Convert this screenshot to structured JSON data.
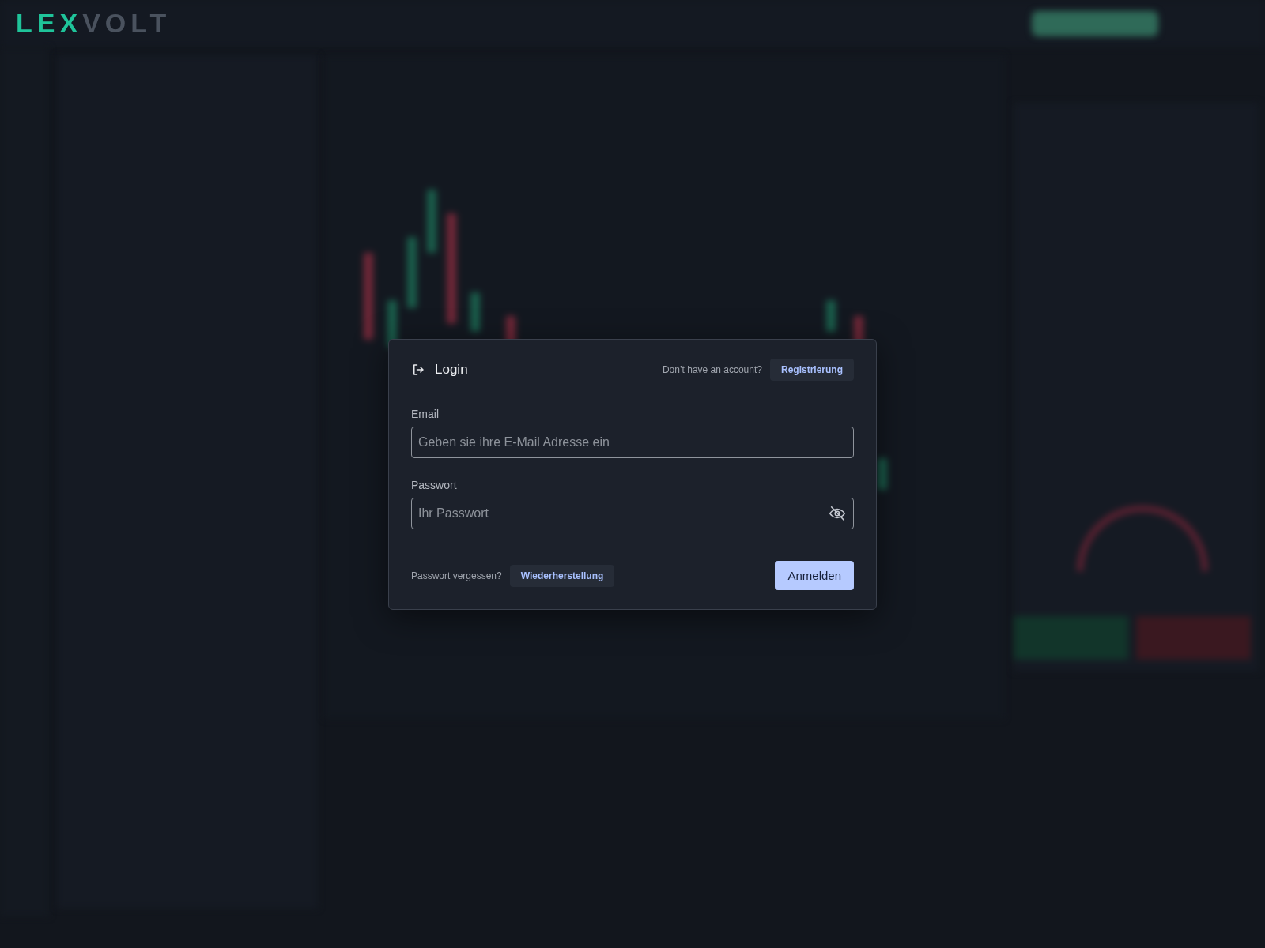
{
  "logo": {
    "accent": "LEX",
    "rest": "VOLT"
  },
  "dialog": {
    "title": "Login",
    "signup_prompt": "Don’t have an account?",
    "signup_button": "Registrierung",
    "fields": [
      {
        "label": "Email",
        "placeholder": "Geben sie ihre E-Mail Adresse ein",
        "kind": "email"
      },
      {
        "label": "Passwort",
        "placeholder": "Ihr Passwort",
        "kind": "password"
      }
    ],
    "forgot_prompt": "Passwort vergessen?",
    "recover_button": "Wiederherstellung",
    "submit_button": "Anmelden"
  }
}
